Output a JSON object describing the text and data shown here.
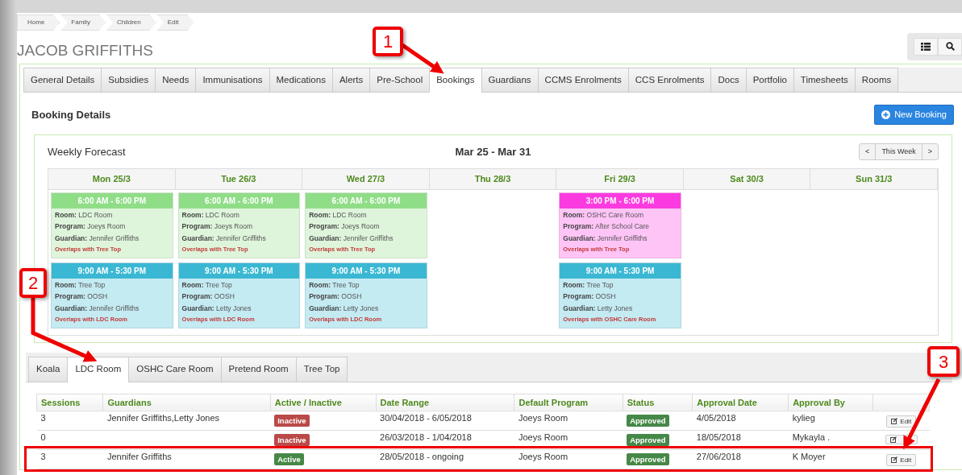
{
  "breadcrumb": [
    {
      "label": "Home"
    },
    {
      "label": "Family"
    },
    {
      "label": "Children"
    },
    {
      "label": "Edit"
    }
  ],
  "title": "JACOB GRIFFITHS",
  "tabs": [
    {
      "label": "General Details",
      "selected": false
    },
    {
      "label": "Subsidies",
      "selected": false
    },
    {
      "label": "Needs",
      "selected": false
    },
    {
      "label": "Immunisations",
      "selected": false
    },
    {
      "label": "Medications",
      "selected": false
    },
    {
      "label": "Alerts",
      "selected": false
    },
    {
      "label": "Pre-School",
      "selected": false
    },
    {
      "label": "Bookings",
      "selected": true
    },
    {
      "label": "Guardians",
      "selected": false
    },
    {
      "label": "CCMS Enrolments",
      "selected": false
    },
    {
      "label": "CCS Enrolments",
      "selected": false
    },
    {
      "label": "Docs",
      "selected": false
    },
    {
      "label": "Portfolio",
      "selected": false
    },
    {
      "label": "Timesheets",
      "selected": false
    },
    {
      "label": "Rooms",
      "selected": false
    }
  ],
  "section_title": "Booking Details",
  "new_booking_button": "New Booking",
  "forecast": {
    "title": "Weekly Forecast",
    "range": "Mar 25 - Mar 31",
    "pager": {
      "prev": "<",
      "current": "This Week",
      "next": ">"
    },
    "days": [
      {
        "label": "Mon 25/3",
        "events": [
          {
            "time": "6:00 AM - 6:00 PM",
            "color": "#90dd88",
            "fields": [
              {
                "label": "Room:",
                "value": "LDC Room"
              },
              {
                "label": "Program:",
                "value": "Joeys Room"
              },
              {
                "label": "Guardian:",
                "value": "Jennifer Griffiths"
              }
            ],
            "overlap": "Overlaps with Tree Top"
          },
          {
            "time": "9:00 AM - 5:30 PM",
            "color": "#3ab8d3",
            "fields": [
              {
                "label": "Room:",
                "value": "Tree Top"
              },
              {
                "label": "Program:",
                "value": "OOSH"
              },
              {
                "label": "Guardian:",
                "value": "Jennifer Griffiths"
              }
            ],
            "overlap": "Overlaps with LDC Room"
          }
        ]
      },
      {
        "label": "Tue 26/3",
        "events": [
          {
            "time": "6:00 AM - 6:00 PM",
            "color": "#90dd88",
            "fields": [
              {
                "label": "Room:",
                "value": "LDC Room"
              },
              {
                "label": "Program:",
                "value": "Joeys Room"
              },
              {
                "label": "Guardian:",
                "value": "Jennifer Griffiths"
              }
            ],
            "overlap": "Overlaps with Tree Top"
          },
          {
            "time": "9:00 AM - 5:30 PM",
            "color": "#3ab8d3",
            "fields": [
              {
                "label": "Room:",
                "value": "Tree Top"
              },
              {
                "label": "Program:",
                "value": "OOSH"
              },
              {
                "label": "Guardian:",
                "value": "Letty Jones"
              }
            ],
            "overlap": "Overlaps with LDC Room"
          }
        ]
      },
      {
        "label": "Wed 27/3",
        "events": [
          {
            "time": "6:00 AM - 6:00 PM",
            "color": "#90dd88",
            "fields": [
              {
                "label": "Room:",
                "value": "LDC Room"
              },
              {
                "label": "Program:",
                "value": "Joeys Room"
              },
              {
                "label": "Guardian:",
                "value": "Jennifer Griffiths"
              }
            ],
            "overlap": "Overlaps with Tree Top"
          },
          {
            "time": "9:00 AM - 5:30 PM",
            "color": "#3ab8d3",
            "fields": [
              {
                "label": "Room:",
                "value": "Tree Top"
              },
              {
                "label": "Program:",
                "value": "OOSH"
              },
              {
                "label": "Guardian:",
                "value": "Letty Jones"
              }
            ],
            "overlap": "Overlaps with LDC Room"
          }
        ]
      },
      {
        "label": "Thu 28/3"
      },
      {
        "label": "Fri 29/3",
        "events": [
          {
            "time": "3:00 PM - 6:00 PM",
            "color": "#fb3be0",
            "fields": [
              {
                "label": "Room:",
                "value": "OSHC Care Room"
              },
              {
                "label": "Program:",
                "value": "After School Care"
              },
              {
                "label": "Guardian:",
                "value": "Jennifer Griffiths"
              }
            ],
            "overlap": "Overlaps with Tree Top"
          },
          {
            "time": "9:00 AM - 5:30 PM",
            "color": "#3ab8d3",
            "fields": [
              {
                "label": "Room:",
                "value": "Tree Top"
              },
              {
                "label": "Program:",
                "value": "OOSH"
              },
              {
                "label": "Guardian:",
                "value": "Letty Jones"
              }
            ],
            "overlap": "Overlaps with OSHC Care Room"
          }
        ]
      },
      {
        "label": "Sat 30/3"
      },
      {
        "label": "Sun 31/3"
      }
    ]
  },
  "room_tabs": [
    {
      "label": "Koala",
      "selected": false
    },
    {
      "label": "LDC Room",
      "selected": true
    },
    {
      "label": "OSHC Care Room",
      "selected": false
    },
    {
      "label": "Pretend Room",
      "selected": false
    },
    {
      "label": "Tree Top",
      "selected": false
    }
  ],
  "table": {
    "columns": [
      "Sessions",
      "Guardians",
      "Active / Inactive",
      "Date Range",
      "Default Program",
      "Status",
      "Approval Date",
      "Approval By"
    ],
    "rows": [
      {
        "sessions": "3",
        "guardians": "Jennifer Griffiths,Letty Jones",
        "active": false,
        "active_label": "Inactive",
        "date_range": "30/04/2018 - 6/05/2018",
        "program": "Joeys Room",
        "approved": true,
        "status": "Approved",
        "approval_date": "4/05/2018",
        "approval_by": "kylieg",
        "edit": "Edit",
        "highlighted": false
      },
      {
        "sessions": "0",
        "active": false,
        "active_label": "Inactive",
        "date_range": "26/03/2018 - 1/04/2018",
        "program": "Joeys Room",
        "approved": true,
        "status": "Approved",
        "approval_date": "18/05/2018",
        "approval_by": "Mykayla .",
        "highlighted": false
      },
      {
        "sessions": "3",
        "guardians": "Jennifer Griffiths",
        "active": true,
        "active_label": "Active",
        "date_range": "28/05/2018 - ongoing",
        "program": "Joeys Room",
        "approved": true,
        "status": "Approved",
        "approval_date": "27/06/2018",
        "approval_by": "K Moyer",
        "edit": "Edit",
        "highlighted": true
      }
    ]
  },
  "callouts": [
    {
      "number": "1"
    },
    {
      "number": "2"
    },
    {
      "number": "3"
    }
  ]
}
